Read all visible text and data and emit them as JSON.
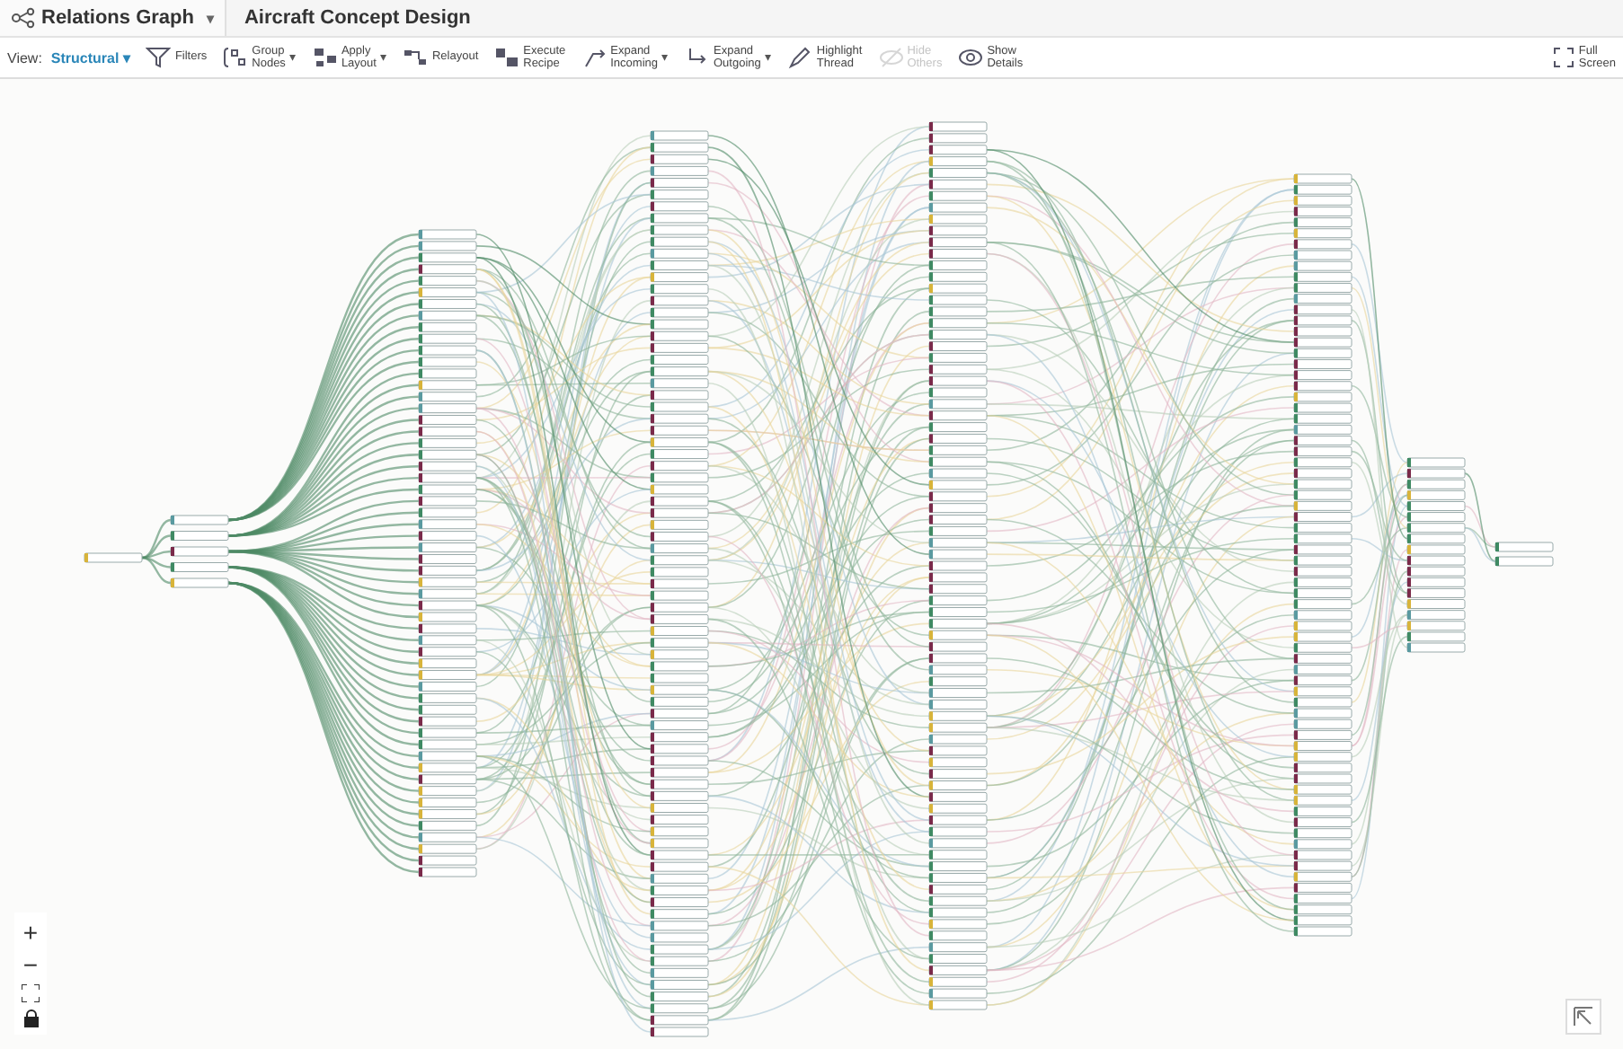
{
  "header": {
    "tab": {
      "label": "Relations Graph",
      "caret": "▾"
    },
    "title": "Aircraft Concept Design"
  },
  "toolbar": {
    "view": {
      "label": "View:",
      "value": "Structural",
      "caret": "▾"
    },
    "tools": [
      {
        "lines": [
          "Filters"
        ],
        "disabled": false
      },
      {
        "lines": [
          "Group",
          "Nodes"
        ],
        "caret": "▾",
        "disabled": false
      },
      {
        "lines": [
          "Apply",
          "Layout"
        ],
        "caret": "▾",
        "disabled": false
      },
      {
        "lines": [
          "Relayout"
        ],
        "disabled": false
      },
      {
        "lines": [
          "Execute",
          "Recipe"
        ],
        "disabled": false
      },
      {
        "lines": [
          "Expand",
          "Incoming"
        ],
        "caret": "▾",
        "disabled": false
      },
      {
        "lines": [
          "Expand",
          "Outgoing"
        ],
        "caret": "▾",
        "disabled": false
      },
      {
        "lines": [
          "Highlight",
          "Thread"
        ],
        "disabled": false
      },
      {
        "lines": [
          "Hide",
          "Others"
        ],
        "disabled": true
      },
      {
        "lines": [
          "Show",
          "Details"
        ],
        "disabled": false
      }
    ],
    "fullscreen": {
      "lines": [
        "Full",
        "Screen"
      ]
    }
  },
  "zoom_controls": [
    {
      "label": "+"
    },
    {
      "label": "−"
    }
  ]
}
